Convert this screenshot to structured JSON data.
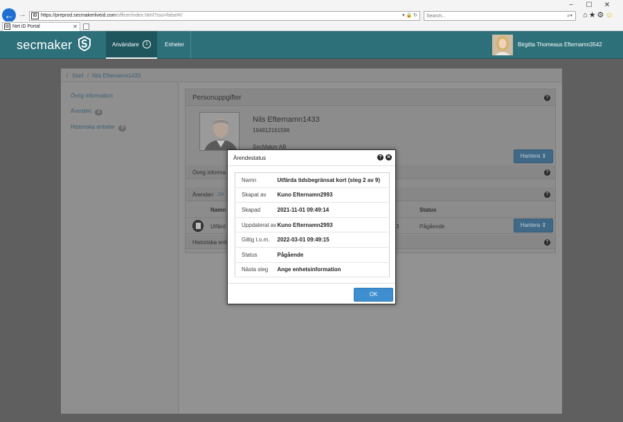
{
  "browser": {
    "url_prefix": "https://",
    "url_host": "preprod.secmakerliveid.com",
    "url_path": "/officer/index.html?sso=false#!/",
    "search_placeholder": "Search...",
    "tab_title": "Net iD Portal"
  },
  "header": {
    "logo": "secmaker",
    "nav": [
      {
        "label": "Användare",
        "badge": "1"
      },
      {
        "label": "Enheter"
      }
    ],
    "user_name": "Birgitta Thomeaus Efternamn3542"
  },
  "breadcrumb": [
    "Start",
    "Nils Efternamn1433"
  ],
  "sidebar": {
    "items": [
      {
        "label": "Övrig information"
      },
      {
        "label": "Ärenden",
        "badge": "1"
      },
      {
        "label": "Historiska enheter",
        "badge": "0"
      }
    ]
  },
  "person": {
    "panel_title": "Personuppgifter",
    "name": "Nils Efternamn1433",
    "id_number": "194812161596",
    "organization": "SecMaker AB",
    "manage_label": "Hantera"
  },
  "other_info": {
    "title": "Övrig informa"
  },
  "cases": {
    "title": "Ärenden",
    "filter": "Dö",
    "col_name": "Namn",
    "col_status": "Status",
    "row_name": "Utfärd",
    "row_id_fragment": "3",
    "row_status": "Pågående",
    "manage_label": "Hantera"
  },
  "history": {
    "title": "Historiska enh"
  },
  "modal": {
    "title": "Ärendestatus",
    "rows": [
      {
        "key": "Namn",
        "value": "Utfärda tidsbegränsat kort (steg 2 av 9)"
      },
      {
        "key": "Skapat av",
        "value": "Kuno Efternamn2993"
      },
      {
        "key": "Skapad",
        "value": "2021-11-01 09:49:14"
      },
      {
        "key": "Uppdaterat av",
        "value": "Kuno Efternamn2993"
      },
      {
        "key": "Giltig t.o.m.",
        "value": "2022-03-01 09:49:15"
      },
      {
        "key": "Status",
        "value": "Pågående"
      },
      {
        "key": "Nästa steg",
        "value": "Ange enhetsinformation"
      }
    ],
    "ok_label": "OK"
  },
  "colors": {
    "header_bg": "#2d7079",
    "nav_active_bg": "#1f555c",
    "button_primary": "#3f8ecf",
    "link": "#3e5e72"
  }
}
